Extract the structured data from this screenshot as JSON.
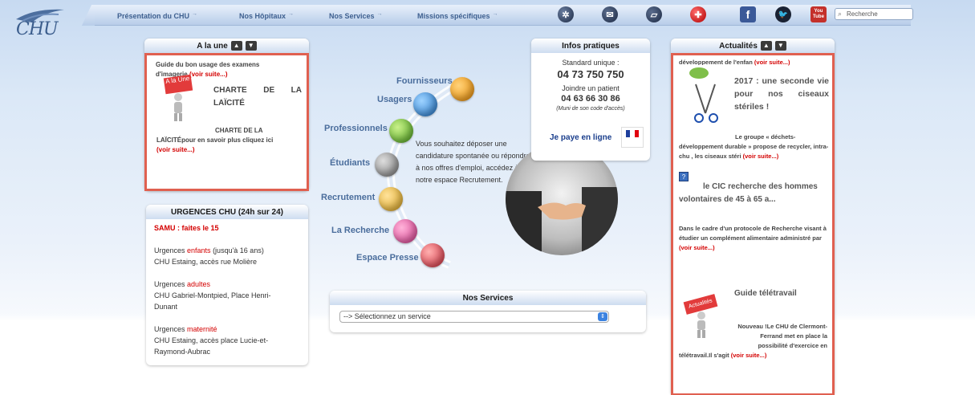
{
  "header": {
    "logo_text": "CHU",
    "nav": [
      {
        "label": "Présentation du CHU"
      },
      {
        "label": "Nos Hôpitaux"
      },
      {
        "label": "Nos Services"
      },
      {
        "label": "Missions spécifiques"
      }
    ],
    "search_placeholder": "Recherche",
    "youtube_label": "You Tube"
  },
  "a_la_une": {
    "title": "A la une",
    "guide_text": "Guide du bon usage des examens d'imagerie",
    "guide_link": "(voir suite...)",
    "badge": "A la Une",
    "charte_title": "CHARTE DE LA LAÏCITÉ",
    "charte_sub": "CHARTE DE LA",
    "charte_body": "LAÏCITÉpour en savoir plus cliquez ici",
    "charte_link": "(voir suite...)"
  },
  "urgences": {
    "title": "URGENCES CHU (24h sur 24)",
    "samu": "SAMU : faites le 15",
    "items": [
      {
        "prefix": "Urgences ",
        "highlight": "enfants",
        "suffix": " (jusqu'à 16 ans)",
        "line2": "CHU Estaing, accès rue Molière"
      },
      {
        "prefix": "Urgences ",
        "highlight": "adultes",
        "suffix": "",
        "line2": "CHU Gabriel-Montpied, Place Henri-Dunant"
      },
      {
        "prefix": "Urgences ",
        "highlight": "maternité",
        "suffix": "",
        "line2": "CHU Estaing, accès place Lucie-et-Raymond-Aubrac"
      }
    ]
  },
  "center": {
    "labels": [
      "Fournisseurs",
      "Usagers",
      "Professionnels",
      "Étudiants",
      "Recrutement",
      "La Recherche",
      "Espace Presse"
    ],
    "recrutement_text": "Vous souhaitez déposer une candidature spontanée ou répondre à nos offres d'emploi, accédez à notre espace Recrutement."
  },
  "infos": {
    "title": "Infos pratiques",
    "standard_label": "Standard unique :",
    "standard_number": "04 73 750 750",
    "patient_label": "Joindre un patient",
    "patient_number": "04 63 66 30 86",
    "patient_note": "(Muni de son code d'accès)",
    "pay_label": "Je paye en ligne"
  },
  "services": {
    "title": "Nos Services",
    "select_value": "--> Sélectionnez un service"
  },
  "actualites": {
    "title": "Actualités",
    "top_text": "développement de l'enfan",
    "top_link": "(voir suite...)",
    "item1_title": "2017 : une seconde vie pour nos ciseaux stériles !",
    "item1_body": "Le groupe « déchets-développement durable » propose de recycler, intra-chu , les ciseaux stéri",
    "item1_link": "(voir suite...)",
    "item2_title": "le CIC recherche des hommes volontaires de 45 à 65 a...",
    "item2_body": "Dans le cadre d'un protocole de Recherche visant à étudier un complément alimentaire administré par",
    "item2_link": "(voir suite...)",
    "item3_title": "Guide télétravail",
    "item3_badge": "Actualités",
    "item3_body_a": "Nouveau !Le CHU de Clermont-Ferrand met en place la possibilité d'exercice en",
    "item3_body_b": "télétravail.Il s'agit",
    "item3_link": "(voir suite...)"
  }
}
